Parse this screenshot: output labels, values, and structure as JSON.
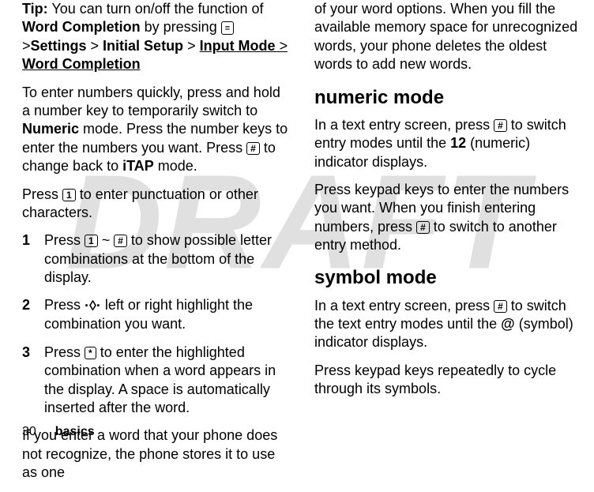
{
  "watermark": "DRAFT",
  "left": {
    "tip_label": "Tip:",
    "tip_part1": " You can turn on/off the function of ",
    "tip_word_completion": "Word Completion",
    "tip_part2": " by pressing ",
    "tip_gt1": " >",
    "tip_settings": "Settings",
    "tip_gt2": " > ",
    "tip_initial_setup": "Initial Setup",
    "tip_gt3": " > ",
    "tip_input_mode": "Input Mode",
    "tip_gt4": " > ",
    "tip_word_completion2": "Word Completion",
    "para2_a": "To enter numbers quickly, press and hold a number key to temporarily switch to ",
    "para2_numeric": "Numeric",
    "para2_b": " mode. Press the number keys to enter the numbers you want. Press ",
    "para2_c": " to change back to ",
    "para2_itap": "iTAP",
    "para2_d": " mode.",
    "para3_a": "Press ",
    "para3_b": " to enter punctuation or other characters.",
    "step1_num": "1",
    "step1_a": "Press ",
    "step1_tilde": " ~ ",
    "step1_b": " to show possible letter combinations at the bottom of the display.",
    "step2_num": "2",
    "step2_a": "Press ",
    "step2_b": " left or right highlight the combination you want.",
    "step3_num": "3",
    "step3_a": "Press ",
    "step3_b": " to enter the highlighted combination when a word appears in the display. A space is automatically inserted after the word.",
    "para4": "If you enter a word that your phone does not recognize, the phone stores it to use as one"
  },
  "right": {
    "para1": "of your word options. When you fill the available memory space for unrecognized words, your phone deletes the oldest words to add new words.",
    "h_numeric": "numeric mode",
    "num_p1_a": "In a text entry screen, press ",
    "num_p1_b": " to switch entry modes until the ",
    "num_p1_12": "12",
    "num_p1_c": " (numeric) indicator displays.",
    "num_p2_a": "Press keypad keys to enter the numbers you want. When you finish entering numbers, press ",
    "num_p2_b": " to switch to another entry method.",
    "h_symbol": "symbol mode",
    "sym_p1_a": "In a text entry screen, press ",
    "sym_p1_b": " to switch the text entry modes until the ",
    "sym_p1_at": "@",
    "sym_p1_c": " (symbol) indicator displays.",
    "sym_p2": "Press keypad keys repeatedly to cycle through its symbols."
  },
  "keys": {
    "menu": "≡",
    "hash": "#",
    "one": "1",
    "star": "*"
  },
  "nav_symbol": "·◊·",
  "footer": {
    "page": "30",
    "label": "basics"
  }
}
